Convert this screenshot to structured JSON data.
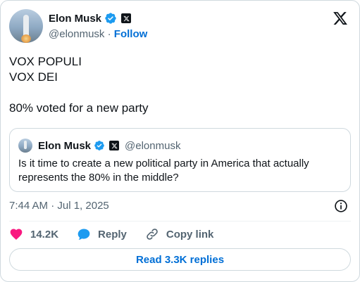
{
  "author": {
    "display_name": "Elon Musk",
    "handle": "@elonmusk",
    "separator": " · ",
    "follow_label": "Follow"
  },
  "tweet": {
    "lines": [
      "VOX POPULI",
      "VOX DEI",
      "80% voted for a new party"
    ]
  },
  "quote": {
    "display_name": "Elon Musk",
    "handle": "@elonmusk",
    "text": "Is it time to create a new political party in America that actually represents the 80% in the middle?"
  },
  "meta": {
    "timestamp": "7:44 AM · Jul 1, 2025"
  },
  "actions": {
    "like_count": "14.2K",
    "reply_label": "Reply",
    "copy_label": "Copy link"
  },
  "footer": {
    "read_replies_label": "Read 3.3K replies"
  },
  "colors": {
    "accent": "#006fd6",
    "verified": "#1d9bf0",
    "like": "#f91880",
    "reply": "#1d9bf0",
    "text": "#0f1419",
    "muted": "#536471",
    "border": "#cfd9de"
  },
  "icons": [
    "verified-badge-icon",
    "x-affiliate-badge-icon",
    "x-logo-icon",
    "info-icon",
    "heart-icon",
    "reply-bubble-icon",
    "link-icon"
  ]
}
